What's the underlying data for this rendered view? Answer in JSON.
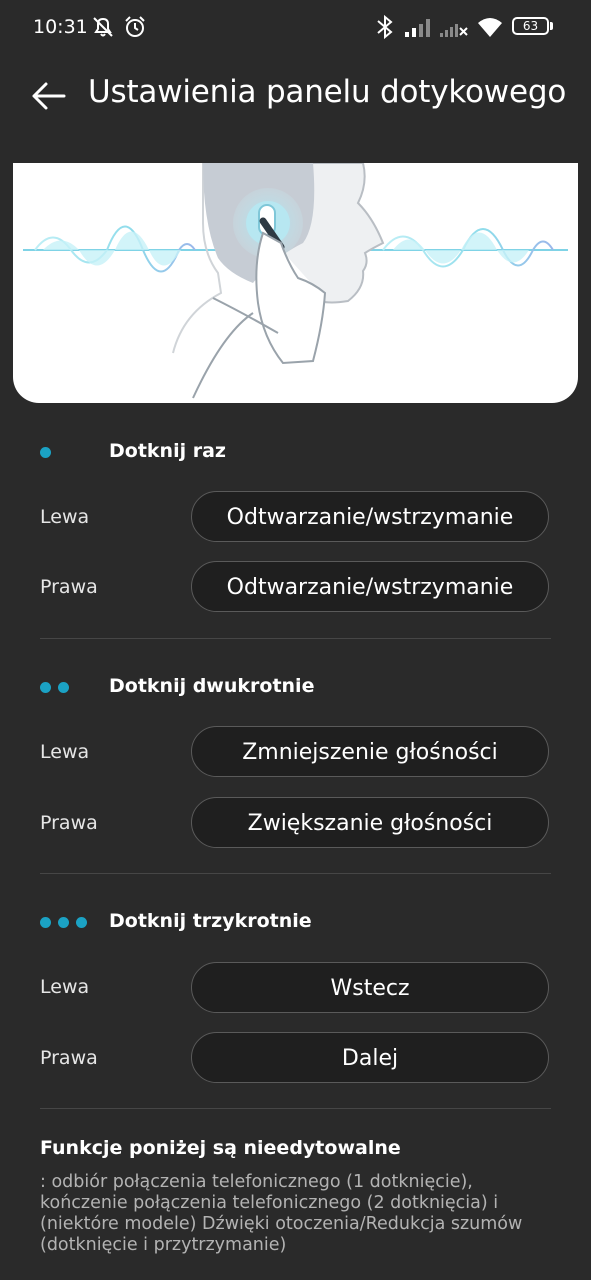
{
  "status_bar": {
    "time": "10:31",
    "battery": "63",
    "icons": [
      "mute-icon",
      "alarm-icon",
      "bluetooth-icon",
      "signal-icon",
      "signal-off-icon",
      "wifi-icon",
      "battery-icon"
    ]
  },
  "header": {
    "title": "Ustawienia panelu dotykowego",
    "back_icon": "back-arrow-icon"
  },
  "accent_color": "#1ba2c4",
  "sections": [
    {
      "title": "Dotknij raz",
      "dots": 1,
      "rows": [
        {
          "label": "Lewa",
          "value": "Odtwarzanie/wstrzymanie"
        },
        {
          "label": "Prawa",
          "value": "Odtwarzanie/wstrzymanie"
        }
      ]
    },
    {
      "title": "Dotknij dwukrotnie",
      "dots": 2,
      "rows": [
        {
          "label": "Lewa",
          "value": "Zmniejszenie głośności"
        },
        {
          "label": "Prawa",
          "value": "Zwiększanie głośności"
        }
      ]
    },
    {
      "title": "Dotknij trzykrotnie",
      "dots": 3,
      "rows": [
        {
          "label": "Lewa",
          "value": "Wstecz"
        },
        {
          "label": "Prawa",
          "value": "Dalej"
        }
      ]
    }
  ],
  "note": {
    "title": "Funkcje poniżej są nieedytowalne",
    "body": ": odbiór połączenia telefonicznego (1 dotknięcie), kończenie połączenia telefonicznego (2 dotknięcia) i (niektóre modele) Dźwięki otoczenia/Redukcja szumów (dotknięcie i przytrzymanie)"
  }
}
